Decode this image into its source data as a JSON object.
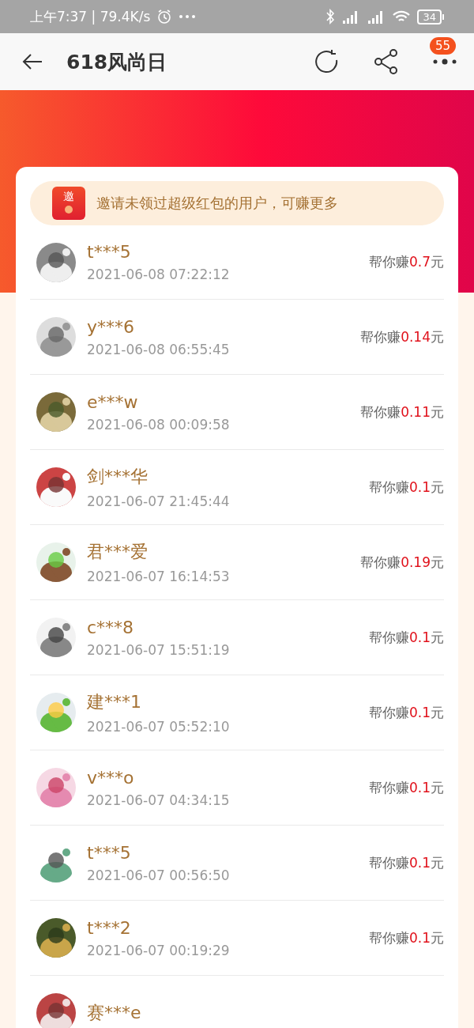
{
  "status_bar": {
    "time": "上午7:37 | 79.4K/s",
    "battery": "34"
  },
  "header": {
    "title": "618风尚日",
    "badge": "55"
  },
  "banner": {
    "icon_text": "邀",
    "text": "邀请未领过超级红包的用户，可赚更多"
  },
  "rows": [
    {
      "name": "t***5",
      "time": "2021-06-08 07:22:12",
      "prefix": "帮你赚",
      "amount": "0.7",
      "unit": "元"
    },
    {
      "name": "y***6",
      "time": "2021-06-08 06:55:45",
      "prefix": "帮你赚",
      "amount": "0.14",
      "unit": "元"
    },
    {
      "name": "e***w",
      "time": "2021-06-08 00:09:58",
      "prefix": "帮你赚",
      "amount": "0.11",
      "unit": "元"
    },
    {
      "name": "剑***华",
      "time": "2021-06-07 21:45:44",
      "prefix": "帮你赚",
      "amount": "0.1",
      "unit": "元"
    },
    {
      "name": "君***爱",
      "time": "2021-06-07 16:14:53",
      "prefix": "帮你赚",
      "amount": "0.19",
      "unit": "元"
    },
    {
      "name": "c***8",
      "time": "2021-06-07 15:51:19",
      "prefix": "帮你赚",
      "amount": "0.1",
      "unit": "元"
    },
    {
      "name": "建***1",
      "time": "2021-06-07 05:52:10",
      "prefix": "帮你赚",
      "amount": "0.1",
      "unit": "元"
    },
    {
      "name": "v***o",
      "time": "2021-06-07 04:34:15",
      "prefix": "帮你赚",
      "amount": "0.1",
      "unit": "元"
    },
    {
      "name": "t***5",
      "time": "2021-06-07 00:56:50",
      "prefix": "帮你赚",
      "amount": "0.1",
      "unit": "元"
    },
    {
      "name": "t***2",
      "time": "2021-06-07 00:19:29",
      "prefix": "帮你赚",
      "amount": "0.1",
      "unit": "元"
    },
    {
      "name": "赛***e"
    }
  ]
}
